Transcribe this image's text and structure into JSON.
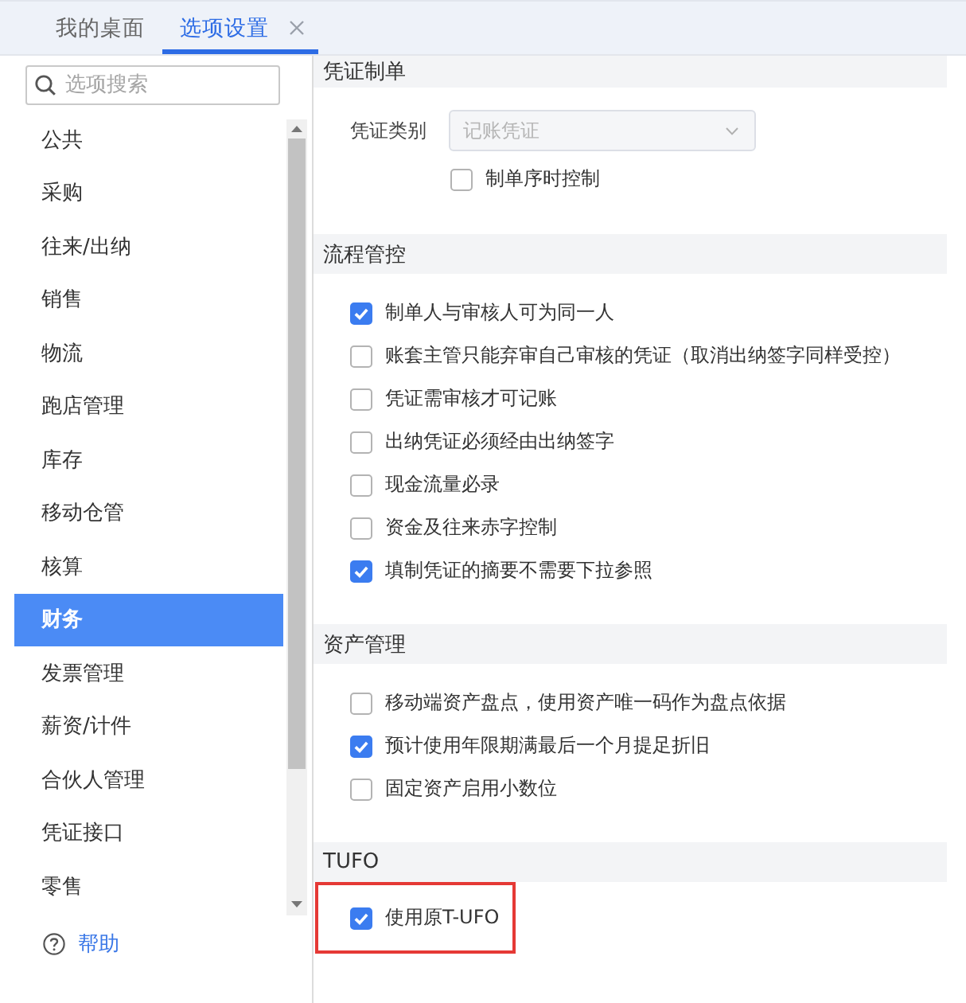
{
  "tabs": [
    {
      "label": "我的桌面",
      "selected": false,
      "closable": false
    },
    {
      "label": "选项设置",
      "selected": true,
      "closable": true
    }
  ],
  "sidebar": {
    "search": {
      "placeholder": "选项搜索"
    },
    "items": [
      {
        "label": "公共",
        "selected": false
      },
      {
        "label": "采购",
        "selected": false
      },
      {
        "label": "往来/出纳",
        "selected": false
      },
      {
        "label": "销售",
        "selected": false
      },
      {
        "label": "物流",
        "selected": false
      },
      {
        "label": "跑店管理",
        "selected": false
      },
      {
        "label": "库存",
        "selected": false
      },
      {
        "label": "移动仓管",
        "selected": false
      },
      {
        "label": "核算",
        "selected": false
      },
      {
        "label": "财务",
        "selected": true
      },
      {
        "label": "发票管理",
        "selected": false
      },
      {
        "label": "薪资/计件",
        "selected": false
      },
      {
        "label": "合伙人管理",
        "selected": false
      },
      {
        "label": "凭证接口",
        "selected": false
      },
      {
        "label": "零售",
        "selected": false
      }
    ],
    "help": {
      "label": "帮助"
    }
  },
  "sections": [
    {
      "title": "凭证制单",
      "rows": [
        {
          "kind": "select",
          "label": "凭证类别",
          "value": "记账凭证",
          "disabled": true,
          "highlighted": false
        },
        {
          "kind": "suboption",
          "label": "制单序时控制",
          "checked": false,
          "highlighted": false
        }
      ]
    },
    {
      "title": "流程管控",
      "rows": [
        {
          "kind": "option",
          "label": "制单人与审核人可为同一人",
          "checked": true,
          "highlighted": false
        },
        {
          "kind": "option",
          "label": "账套主管只能弃审自己审核的凭证（取消出纳签字同样受控）",
          "checked": false,
          "highlighted": false
        },
        {
          "kind": "option",
          "label": "凭证需审核才可记账",
          "checked": false,
          "highlighted": false
        },
        {
          "kind": "option",
          "label": "出纳凭证必须经由出纳签字",
          "checked": false,
          "highlighted": false
        },
        {
          "kind": "option",
          "label": "现金流量必录",
          "checked": false,
          "highlighted": false
        },
        {
          "kind": "option",
          "label": "资金及往来赤字控制",
          "checked": false,
          "highlighted": false
        },
        {
          "kind": "option",
          "label": "填制凭证的摘要不需要下拉参照",
          "checked": true,
          "highlighted": false
        }
      ]
    },
    {
      "title": "资产管理",
      "rows": [
        {
          "kind": "option",
          "label": "移动端资产盘点，使用资产唯一码作为盘点依据",
          "checked": false,
          "highlighted": false
        },
        {
          "kind": "option",
          "label": "预计使用年限期满最后一个月提足折旧",
          "checked": true,
          "highlighted": false
        },
        {
          "kind": "option",
          "label": "固定资产启用小数位",
          "checked": false,
          "highlighted": false
        }
      ]
    },
    {
      "title": "TUFO",
      "rows": [
        {
          "kind": "option",
          "label": "使用原T-UFO",
          "checked": true,
          "highlighted": true
        }
      ]
    }
  ]
}
